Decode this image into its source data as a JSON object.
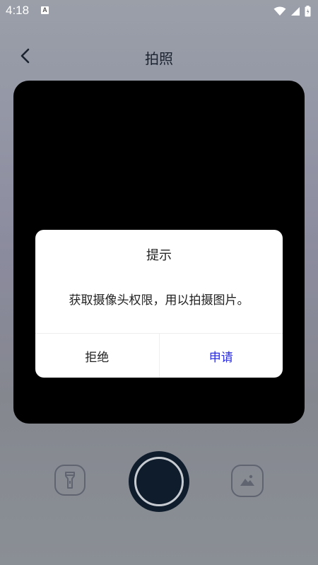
{
  "status_bar": {
    "time": "4:18",
    "notification_badge": "A"
  },
  "header": {
    "title": "拍照"
  },
  "dialog": {
    "title": "提示",
    "message": "获取摄像头权限，用以拍摄图片。",
    "deny_label": "拒绝",
    "apply_label": "申请",
    "apply_color": "#2b2de0"
  },
  "controls": {
    "flash_icon": "flashlight-icon",
    "shutter_icon": "shutter-icon",
    "gallery_icon": "image-gallery-icon"
  }
}
